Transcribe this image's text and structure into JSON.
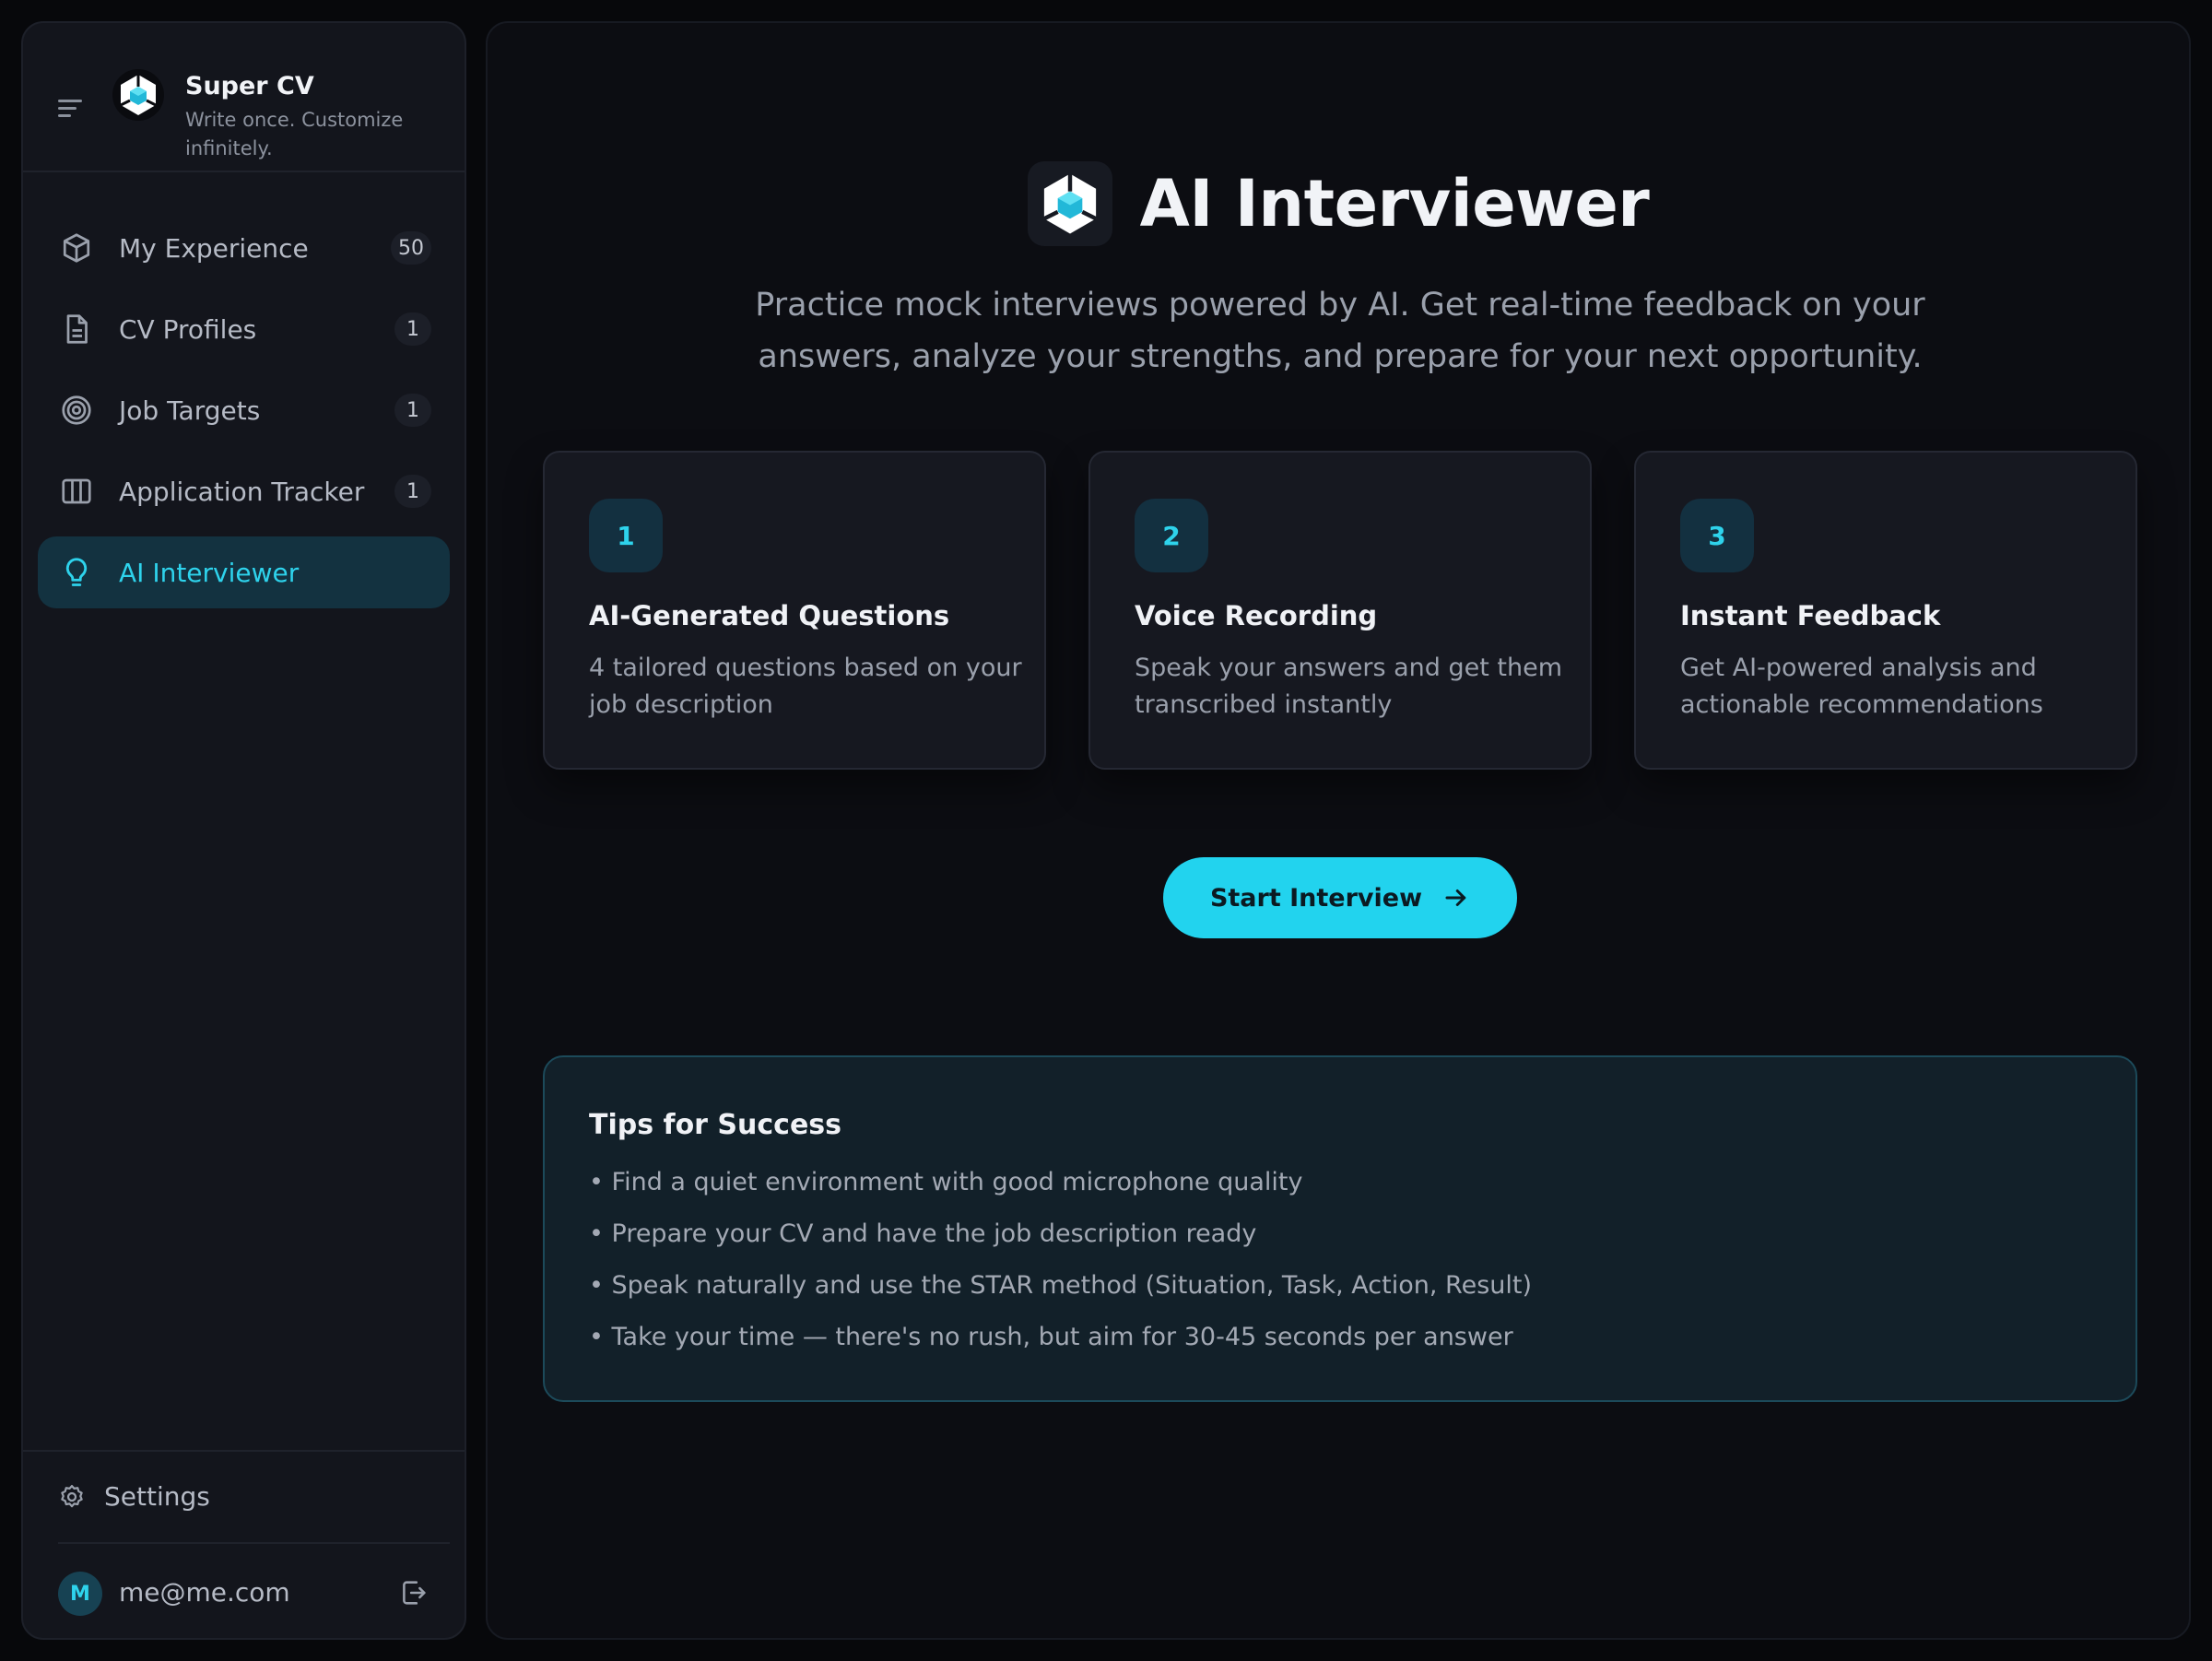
{
  "brand": {
    "title": "Super CV",
    "subtitle": "Write once. Customize infinitely.",
    "logo_icon": "cube-logo-icon"
  },
  "sidebar": {
    "items": [
      {
        "label": "My Experience",
        "badge": "50",
        "icon": "box-icon",
        "active": false
      },
      {
        "label": "CV Profiles",
        "badge": "1",
        "icon": "document-icon",
        "active": false
      },
      {
        "label": "Job Targets",
        "badge": "1",
        "icon": "target-icon",
        "active": false
      },
      {
        "label": "Application Tracker",
        "badge": "1",
        "icon": "columns-icon",
        "active": false
      },
      {
        "label": "AI Interviewer",
        "badge": "",
        "icon": "lightbulb-icon",
        "active": true
      }
    ],
    "settings_label": "Settings",
    "user": {
      "initial": "M",
      "email": "me@me.com"
    }
  },
  "main": {
    "title": "AI Interviewer",
    "description": "Practice mock interviews powered by AI. Get real-time feedback on your answers, analyze your strengths, and prepare for your next opportunity.",
    "cards": [
      {
        "number": "1",
        "title": "AI-Generated Questions",
        "description": "4 tailored questions based on your job description"
      },
      {
        "number": "2",
        "title": "Voice Recording",
        "description": "Speak your answers and get them transcribed instantly"
      },
      {
        "number": "3",
        "title": "Instant Feedback",
        "description": "Get AI-powered analysis and actionable recommendations"
      }
    ],
    "start_button": "Start Interview",
    "tips": {
      "title": "Tips for Success",
      "items": [
        "• Find a quiet environment with good microphone quality",
        "• Prepare your CV and have the job description ready",
        "• Speak naturally and use the STAR method (Situation, Task, Action, Result)",
        "• Take your time — there's no rush, but aim for 30-45 seconds per answer"
      ]
    }
  },
  "colors": {
    "accent": "#22d3ee",
    "active_bg": "#133240",
    "sidebar_bg": "#13151c",
    "main_bg": "#0c0d12"
  }
}
